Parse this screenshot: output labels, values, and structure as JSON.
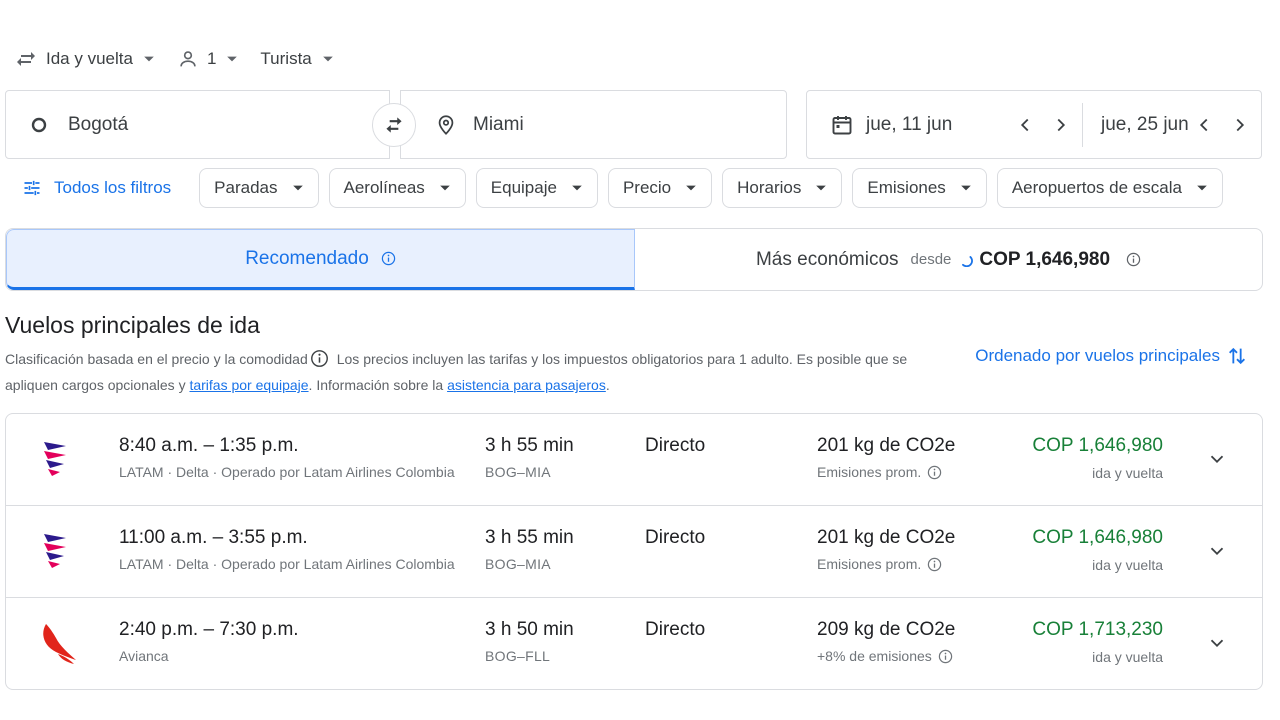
{
  "trip": {
    "type": "Ida y vuelta",
    "passengers": "1",
    "cabin": "Turista"
  },
  "search": {
    "origin": "Bogotá",
    "destination": "Miami",
    "depart_date": "jue, 11 jun",
    "return_date": "jue, 25 jun"
  },
  "filters": {
    "all_label": "Todos los filtros",
    "chips": [
      "Paradas",
      "Aerolíneas",
      "Equipaje",
      "Precio",
      "Horarios",
      "Emisiones",
      "Aeropuertos de escala"
    ]
  },
  "tabs": {
    "recommended": "Recomendado",
    "cheapest": "Más económicos",
    "from_label": "desde",
    "cheapest_price": "COP 1,646,980"
  },
  "section": {
    "title": "Vuelos principales de ida",
    "info_part1": "Clasificación basada en el precio y la comodidad",
    "info_part2": "Los precios incluyen las tarifas y los impuestos obligatorios para 1 adulto. Es posible que se apliquen cargos opcionales y ",
    "link_baggage": "tarifas por equipaje",
    "info_part3": ". Información sobre la ",
    "link_assistance": "asistencia para pasajeros",
    "info_part4": ".",
    "sort_label": "Ordenado por vuelos principales"
  },
  "flights": [
    {
      "times": "8:40 a.m. – 1:35 p.m.",
      "airline": "LATAM · Delta · Operado por Latam Airlines Colombia",
      "duration": "3 h 55 min",
      "route": "BOG–MIA",
      "stops": "Directo",
      "emissions": "201 kg de CO2e",
      "emissions_note": "Emisiones prom.",
      "price": "COP 1,646,980",
      "price_type": "ida y vuelta",
      "logo": "latam-logo-icon"
    },
    {
      "times": "11:00 a.m. – 3:55 p.m.",
      "airline": "LATAM · Delta · Operado por Latam Airlines Colombia",
      "duration": "3 h 55 min",
      "route": "BOG–MIA",
      "stops": "Directo",
      "emissions": "201 kg de CO2e",
      "emissions_note": "Emisiones prom.",
      "price": "COP 1,646,980",
      "price_type": "ida y vuelta",
      "logo": "latam-logo-icon"
    },
    {
      "times": "2:40 p.m. – 7:30 p.m.",
      "airline": "Avianca",
      "duration": "3 h 50 min",
      "route": "BOG–FLL",
      "stops": "Directo",
      "emissions": "209 kg de CO2e",
      "emissions_note": "+8% de emisiones",
      "price": "COP 1,713,230",
      "price_type": "ida y vuelta",
      "logo": "avianca-logo-icon"
    }
  ],
  "colors": {
    "accent": "#1a73e8",
    "price_green": "#188038",
    "border": "#dadce0",
    "latam_magenta": "#e3005b",
    "latam_indigo": "#2c1a8c",
    "avianca_red": "#e1251b"
  }
}
